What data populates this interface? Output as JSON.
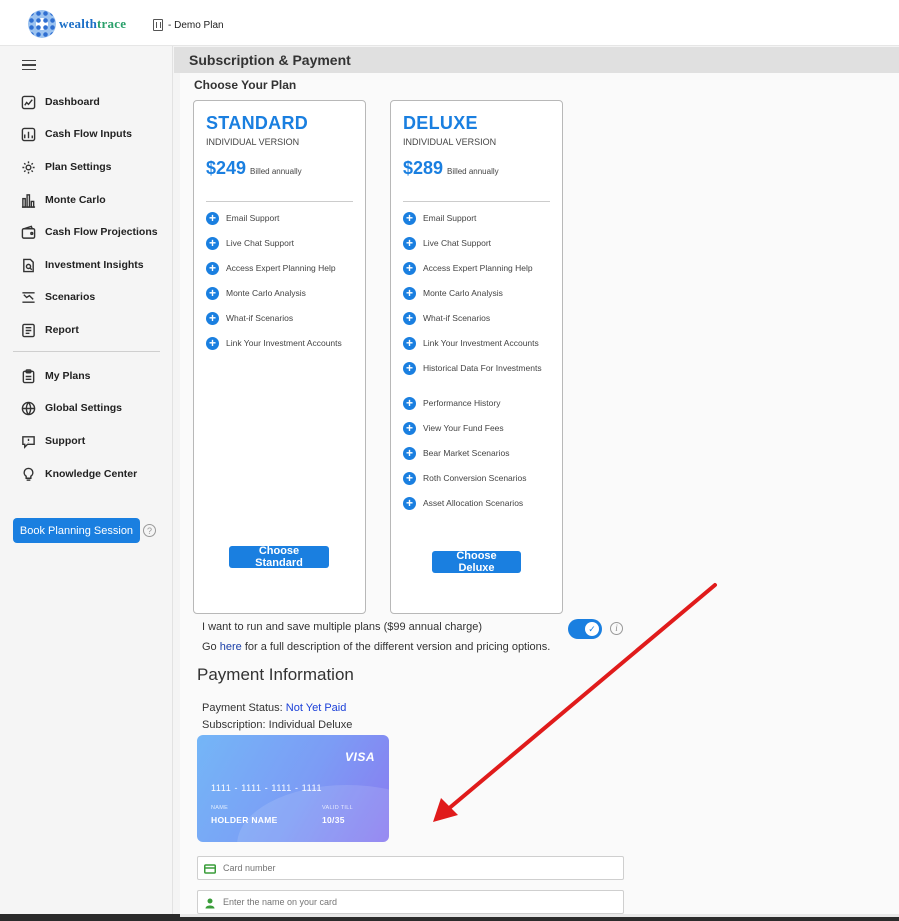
{
  "brand": {
    "prefix": "wealth",
    "suffix": "trace"
  },
  "plan_label": "- Demo Plan",
  "page_title": "Subscription & Payment",
  "choose_plan_title": "Choose Your Plan",
  "sidebar": {
    "items": [
      {
        "label": "Dashboard",
        "icon": "dashboard-icon"
      },
      {
        "label": "Cash Flow Inputs",
        "icon": "cash-flow-inputs-icon"
      },
      {
        "label": "Plan Settings",
        "icon": "gear-icon"
      },
      {
        "label": "Monte Carlo",
        "icon": "bar-chart-icon"
      },
      {
        "label": "Cash Flow Projections",
        "icon": "wallet-icon"
      },
      {
        "label": "Investment Insights",
        "icon": "document-search-icon"
      },
      {
        "label": "Scenarios",
        "icon": "scenarios-icon"
      },
      {
        "label": "Report",
        "icon": "report-icon"
      }
    ],
    "secondary_items": [
      {
        "label": "My Plans",
        "icon": "clipboard-icon"
      },
      {
        "label": "Global Settings",
        "icon": "globe-icon"
      },
      {
        "label": "Support",
        "icon": "support-icon"
      },
      {
        "label": "Knowledge Center",
        "icon": "lightbulb-icon"
      }
    ],
    "book_button": "Book Planning Session"
  },
  "plans": [
    {
      "name": "STANDARD",
      "version": "INDIVIDUAL VERSION",
      "price": "$249",
      "billing": "Billed annually",
      "features": [
        "Email Support",
        "Live Chat Support",
        "Access Expert Planning Help",
        "Monte Carlo Analysis",
        "What-if Scenarios",
        "Link Your Investment Accounts"
      ],
      "button": "Choose Standard"
    },
    {
      "name": "DELUXE",
      "version": "INDIVIDUAL VERSION",
      "price": "$289",
      "billing": "Billed annually",
      "features": [
        "Email Support",
        "Live Chat Support",
        "Access Expert Planning Help",
        "Monte Carlo Analysis",
        "What-if Scenarios",
        "Link Your Investment Accounts",
        "Historical Data For Investments",
        "Performance History",
        "View Your Fund Fees",
        "Bear Market Scenarios",
        "Roth Conversion Scenarios",
        "Asset Allocation Scenarios"
      ],
      "button": "Choose Deluxe"
    }
  ],
  "multi_plan": {
    "text": "I want to run and save multiple plans ($99 annual charge)",
    "enabled": true
  },
  "pricing_note": {
    "prefix": "Go ",
    "link": "here",
    "suffix": " for a full description of the different version and pricing options."
  },
  "payment": {
    "title": "Payment Information",
    "status_label": "Payment Status:",
    "status_value": "Not Yet Paid",
    "subscription_text": "Subscription: Individual Deluxe",
    "card": {
      "brand": "VISA",
      "number": "1111 - 1111 - 1111 - 1111",
      "name_label": "NAME",
      "name_value": "HOLDER NAME",
      "valid_label": "VALID TILL",
      "valid_value": "10/35"
    },
    "card_number_placeholder": "Card number",
    "card_name_placeholder": "Enter the name on your card"
  },
  "colors": {
    "accent": "#1a7fe0",
    "arrow": "#e01b1b",
    "status_link": "#1a3fd8"
  }
}
